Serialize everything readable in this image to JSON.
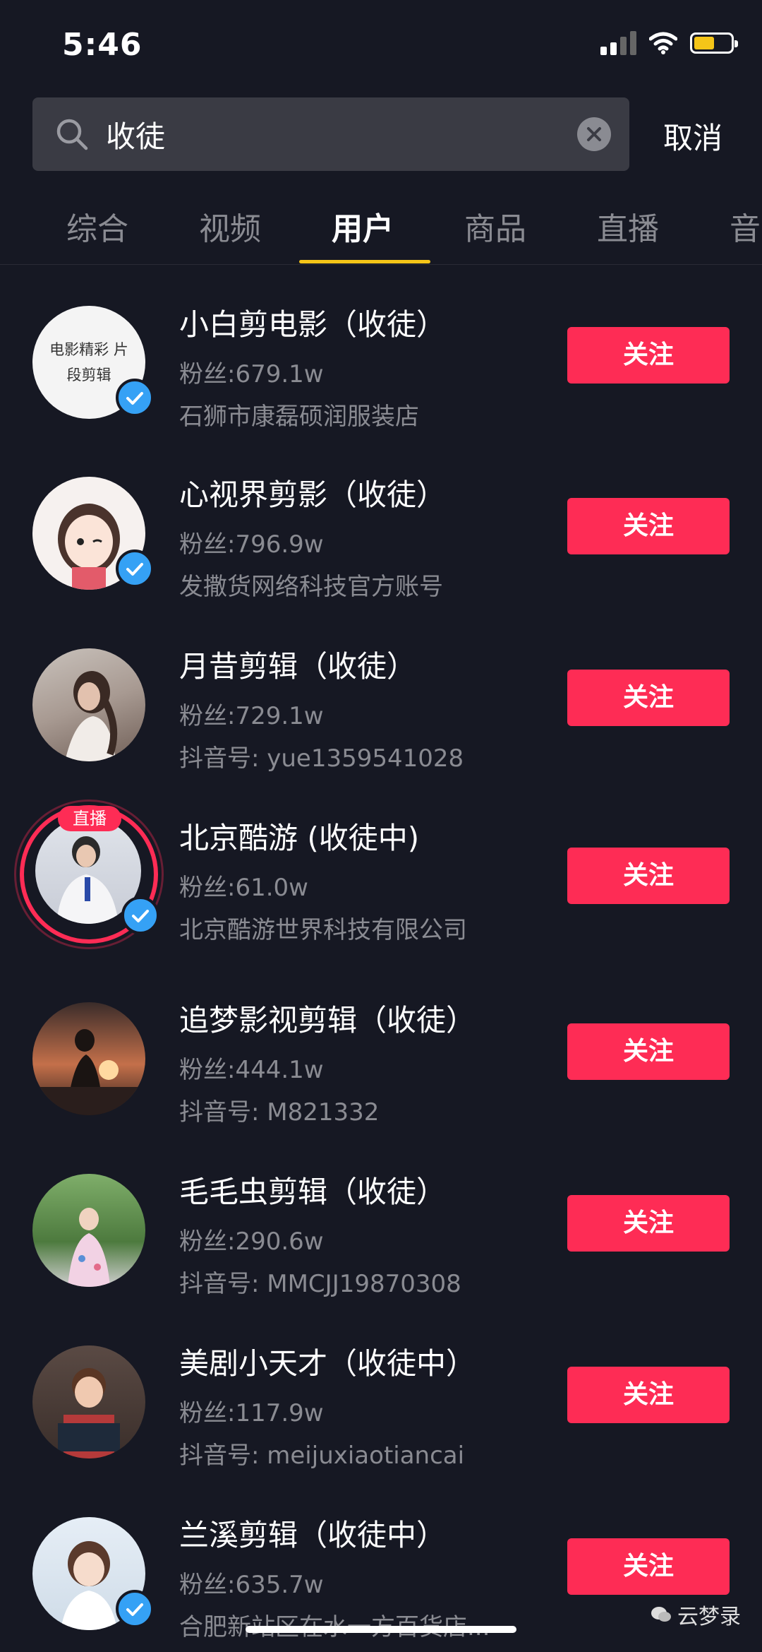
{
  "status": {
    "time": "5:46"
  },
  "search": {
    "query": "收徒",
    "cancel_label": "取消"
  },
  "tabs": [
    {
      "label": "综合"
    },
    {
      "label": "视频"
    },
    {
      "label": "用户"
    },
    {
      "label": "商品"
    },
    {
      "label": "直播"
    },
    {
      "label": "音"
    }
  ],
  "follow_label": "关注",
  "live_label": "直播",
  "users": [
    {
      "name": "小白剪电影（收徒）",
      "fans": "粉丝:679.1w",
      "sub": "石狮市康磊硕润服装店",
      "verified": true,
      "avatar_text": "电影精彩 片段剪辑"
    },
    {
      "name": "心视界剪影（收徒）",
      "fans": "粉丝:796.9w",
      "sub": "发撒货网络科技官方账号",
      "verified": true
    },
    {
      "name": "月昔剪辑（收徒）",
      "fans": "粉丝:729.1w",
      "sub": "抖音号: yue1359541028",
      "verified": false
    },
    {
      "name": "北京酷游 (收徒中)",
      "fans": "粉丝:61.0w",
      "sub": "北京酷游世界科技有限公司",
      "verified": true,
      "live": true
    },
    {
      "name": "追梦影视剪辑（收徒）",
      "fans": "粉丝:444.1w",
      "sub": "抖音号: M821332",
      "verified": false
    },
    {
      "name": "毛毛虫剪辑（收徒）",
      "fans": "粉丝:290.6w",
      "sub": "抖音号: MMCJJ19870308",
      "verified": false
    },
    {
      "name": "美剧小天才（收徒中）",
      "fans": "粉丝:117.9w",
      "sub": "抖音号: meijuxiaotiancai",
      "verified": false
    },
    {
      "name": "兰溪剪辑（收徒中）",
      "fans": "粉丝:635.7w",
      "sub": "合肥新站区在水一方百货店...",
      "verified": true
    }
  ],
  "watermark": "云梦录",
  "colors": {
    "accent": "#fe2c55",
    "tab_indicator": "#f5c518",
    "verified": "#35a1f5",
    "background": "#161823"
  }
}
